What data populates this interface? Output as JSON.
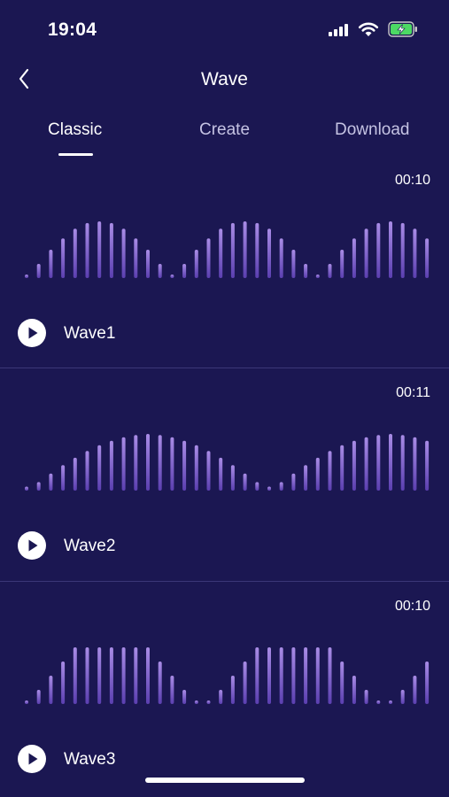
{
  "status_bar": {
    "time": "19:04",
    "icons": [
      "signal-icon",
      "wifi-icon",
      "battery-charging-icon"
    ]
  },
  "nav": {
    "title": "Wave",
    "back_icon": "chevron-left-icon"
  },
  "tabs": [
    {
      "label": "Classic",
      "active": true
    },
    {
      "label": "Create",
      "active": false
    },
    {
      "label": "Download",
      "active": false
    }
  ],
  "waves": [
    {
      "name": "Wave1",
      "duration": "00:10",
      "levels": [
        0.05,
        0.25,
        0.5,
        0.7,
        0.87,
        0.97,
        1,
        0.97,
        0.87,
        0.7,
        0.5,
        0.25,
        0.05,
        0.25,
        0.5,
        0.7,
        0.87,
        0.97,
        1,
        0.97,
        0.87,
        0.7,
        0.5,
        0.25,
        0.05,
        0.25,
        0.5,
        0.7,
        0.87,
        0.97,
        1,
        0.97,
        0.87,
        0.7
      ]
    },
    {
      "name": "Wave2",
      "duration": "00:11",
      "levels": [
        0.07,
        0.15,
        0.3,
        0.45,
        0.58,
        0.7,
        0.8,
        0.88,
        0.94,
        0.98,
        1,
        0.98,
        0.94,
        0.88,
        0.8,
        0.7,
        0.58,
        0.45,
        0.3,
        0.15,
        0.07,
        0.15,
        0.3,
        0.45,
        0.58,
        0.7,
        0.8,
        0.88,
        0.94,
        0.98,
        1,
        0.98,
        0.94,
        0.88
      ]
    },
    {
      "name": "Wave3",
      "duration": "00:10",
      "levels": [
        0.05,
        0.25,
        0.5,
        0.75,
        1,
        1,
        1,
        1,
        1,
        1,
        1,
        0.75,
        0.5,
        0.25,
        0.05,
        0.05,
        0.25,
        0.5,
        0.75,
        1,
        1,
        1,
        1,
        1,
        1,
        1,
        0.75,
        0.5,
        0.25,
        0.05,
        0.05,
        0.25,
        0.5,
        0.75
      ]
    }
  ],
  "colors": {
    "background": "#1b1752",
    "bar_top": "#a98ce6",
    "bar_bottom": "#5b3fb0",
    "divider": "#3b3778",
    "battery_fill": "#4cd964"
  },
  "play_icon": "play-icon"
}
